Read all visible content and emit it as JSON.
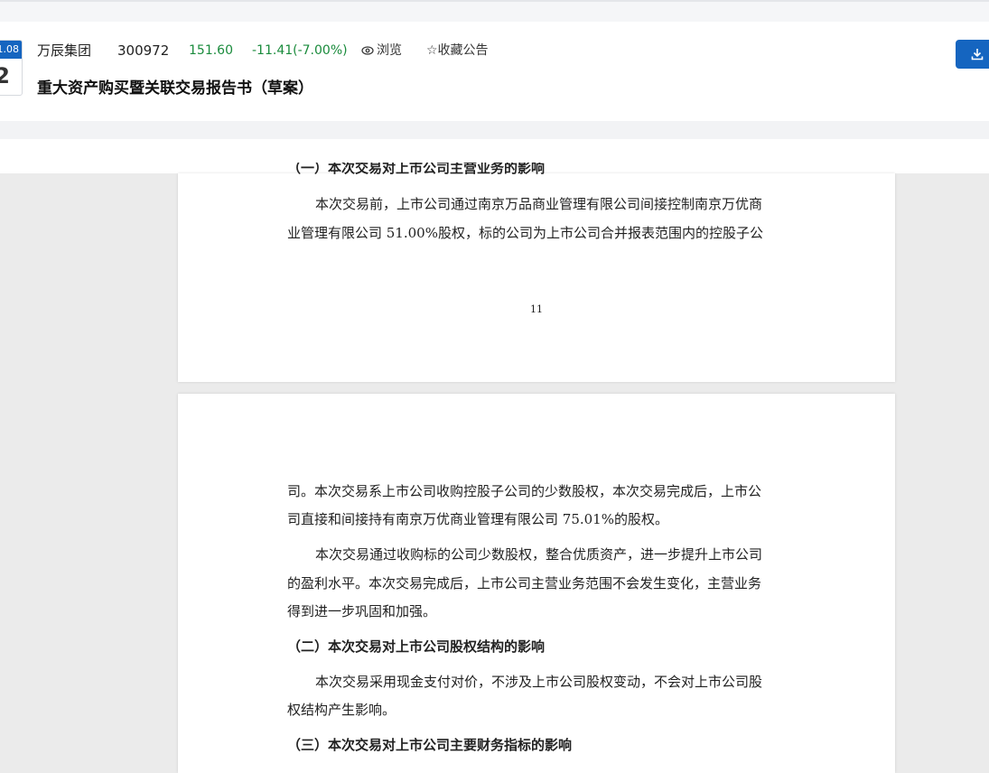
{
  "header": {
    "date_month": "1.08",
    "date_day": "2",
    "stock_name": "万辰集团",
    "stock_code": "300972",
    "price": "151.60",
    "change": "-11.41(-7.00%)",
    "browse_label": "浏览",
    "favorite_label": "☆收藏公告",
    "doc_title": "重大资产购买暨关联交易报告书（草案）",
    "icons": {
      "browse": "eye-icon",
      "download": "download-icon"
    },
    "colors": {
      "price": "#1a8b3c",
      "accent": "#1565c0"
    }
  },
  "page1": {
    "cut_heading": "（一）本次交易对上市公司主营业务的影响",
    "lines": [
      "本次交易前，上市公司通过南京万品商业管理有限公司间接控制南京万优商",
      "业管理有限公司 51.00%股权，标的公司为上市公司合并报表范围内的控股子公"
    ],
    "page_number": "11"
  },
  "page2": {
    "para1": [
      "司。本次交易系上市公司收购控股子公司的少数股权，本次交易完成后，上市公",
      "司直接和间接持有南京万优商业管理有限公司 75.01%的股权。"
    ],
    "para2": [
      "本次交易通过收购标的公司少数股权，整合优质资产，进一步提升上市公司",
      "的盈利水平。本次交易完成后，上市公司主营业务范围不会发生变化，主营业务",
      "得到进一步巩固和加强。"
    ],
    "heading2": "（二）本次交易对上市公司股权结构的影响",
    "para3": [
      "本次交易采用现金支付对价，不涉及上市公司股权变动，不会对上市公司股",
      "权结构产生影响。"
    ],
    "heading3": "（三）本次交易对上市公司主要财务指标的影响"
  }
}
